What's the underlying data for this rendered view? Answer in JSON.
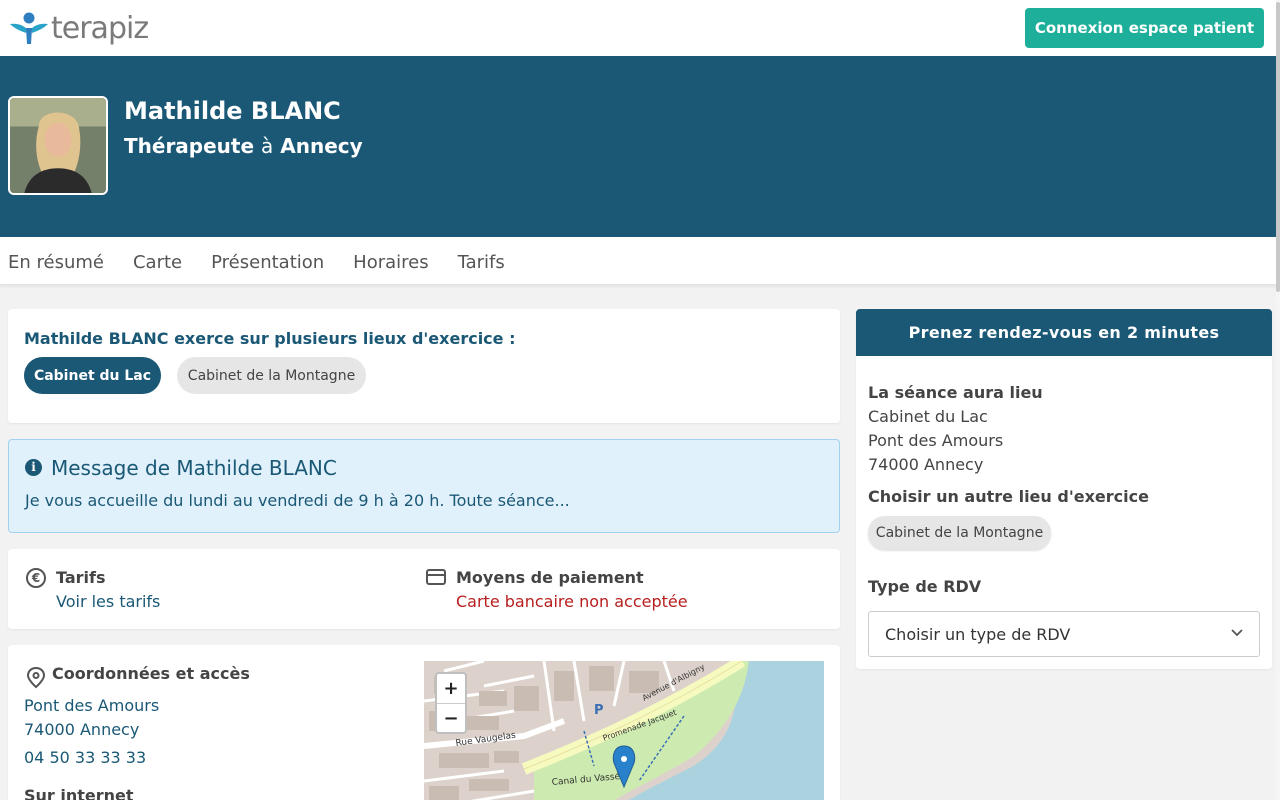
{
  "brand": {
    "name": "terapiz",
    "color": "#1a5876",
    "accent": "#1eaf9a"
  },
  "header": {
    "login_label": "Connexion espace patient"
  },
  "profile": {
    "name": "Mathilde BLANC",
    "profession": "Thérapeute",
    "preposition": "à",
    "city": "Annecy"
  },
  "tabs": [
    "En résumé",
    "Carte",
    "Présentation",
    "Horaires",
    "Tarifs"
  ],
  "lieux": {
    "title": "Mathilde BLANC exerce sur plusieurs lieux d'exercice :",
    "options": [
      "Cabinet du Lac",
      "Cabinet de la Montagne"
    ],
    "selected": "Cabinet du Lac"
  },
  "message": {
    "icon": "info-icon",
    "title": "Message de Mathilde BLANC",
    "text": "Je vous accueille du lundi au vendredi de 9 h à 20 h. Toute séance..."
  },
  "tarifs": {
    "icon": "euro-icon",
    "label": "Tarifs",
    "link": "Voir les tarifs",
    "payment_icon": "credit-card-icon",
    "payment_label": "Moyens de paiement",
    "payment_value": "Carte bancaire non acceptée",
    "payment_color": "#b81e1e"
  },
  "coordonnees": {
    "icon": "location-pin-icon",
    "title": "Coordonnées et accès",
    "address_line1": "Pont des Amours",
    "address_line2": "74000 Annecy",
    "phone": "04 50 33 33 33",
    "internet_label": "Sur internet"
  },
  "map": {
    "zoom_in": "+",
    "zoom_out": "−",
    "labels": [
      "Rue Vaugelas",
      "Promenade Jacquet",
      "Avenue d'Albigny",
      "Canal du Vassé",
      "P"
    ]
  },
  "booking": {
    "header": "Prenez rendez-vous en 2 minutes",
    "lieu_label": "La séance aura lieu",
    "lieu_name": "Cabinet du Lac",
    "lieu_street": "Pont des Amours",
    "lieu_city": "74000 Annecy",
    "other_label": "Choisir un autre lieu d'exercice",
    "other_option": "Cabinet de la Montagne",
    "type_label": "Type de RDV",
    "type_placeholder": "Choisir un type de RDV"
  }
}
